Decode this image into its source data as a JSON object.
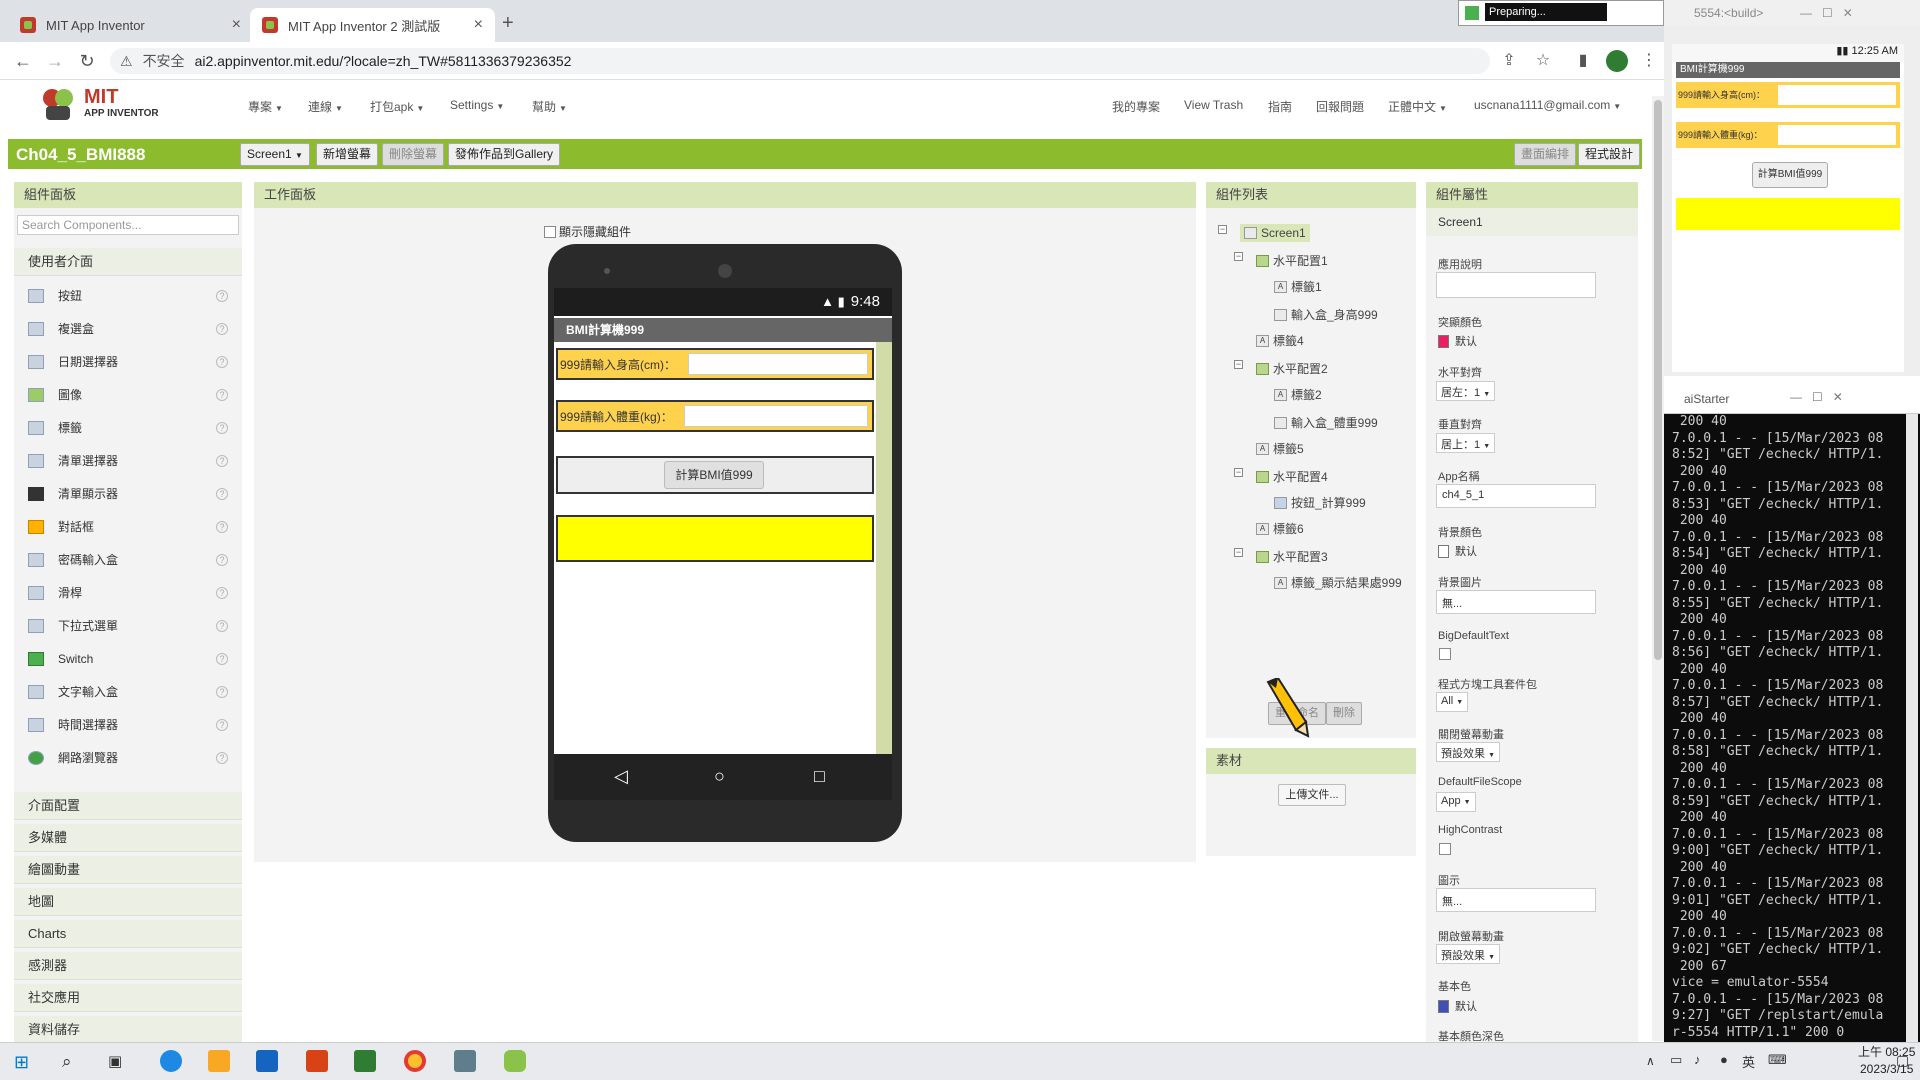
{
  "browser": {
    "tabs": [
      {
        "title": "MIT App Inventor"
      },
      {
        "title": "MIT App Inventor 2 測試版"
      }
    ],
    "insecure_label": "不安全",
    "url": "ai2.appinventor.mit.edu/?locale=zh_TW#5811336379236352"
  },
  "header": {
    "logo_line1": "MIT",
    "logo_line2": "APP INVENTOR",
    "menu_left": [
      "專案",
      "連線",
      "打包apk",
      "Settings",
      "幫助"
    ],
    "menu_right": [
      "我的專案",
      "View Trash",
      "指南",
      "回報問題",
      "正體中文",
      "uscnana1111@gmail.com"
    ]
  },
  "toolbar": {
    "project_name": "Ch04_5_BMI888",
    "screen_select": "Screen1",
    "add_screen": "新增螢幕",
    "remove_screen": "刪除螢幕",
    "publish": "發佈作品到Gallery",
    "designer": "畫面編排",
    "blocks": "程式設計"
  },
  "palette": {
    "title": "組件面板",
    "search_placeholder": "Search Components...",
    "section_ui": "使用者介面",
    "items": [
      "按鈕",
      "複選盒",
      "日期選擇器",
      "圖像",
      "標籤",
      "清單選擇器",
      "清單顯示器",
      "對話框",
      "密碼輸入盒",
      "滑桿",
      "下拉式選單",
      "Switch",
      "文字輸入盒",
      "時間選擇器",
      "網路瀏覽器"
    ],
    "sections": [
      "介面配置",
      "多媒體",
      "繪圖動畫",
      "地圖",
      "Charts",
      "感測器",
      "社交應用",
      "資料儲存"
    ]
  },
  "viewer": {
    "title": "工作面板",
    "show_hidden": "顯示隱藏組件",
    "time": "9:48",
    "app_title": "BMI計算機999",
    "height_label": "999請輸入身高(cm)：",
    "weight_label": "999請輸入體重(kg)：",
    "calc_button": "計算BMI值999"
  },
  "components": {
    "title": "組件列表",
    "tree": [
      "Screen1",
      "水平配置1",
      "標籤1",
      "輸入盒_身高999",
      "標籤4",
      "水平配置2",
      "標籤2",
      "輸入盒_體重999",
      "標籤5",
      "水平配置4",
      "按鈕_計算999",
      "標籤6",
      "水平配置3",
      "標籤_顯示結果處999"
    ],
    "rename": "重新命名",
    "delete": "刪除",
    "media_title": "素材",
    "upload": "上傳文件..."
  },
  "properties": {
    "title": "組件屬性",
    "component": "Screen1",
    "about_label": "應用說明",
    "accent_label": "突顯顏色",
    "accent_value": "默认",
    "accent_color": "#e91e63",
    "halign_label": "水平對齊",
    "halign_value": "居左：1",
    "valign_label": "垂直對齊",
    "valign_value": "居上：1",
    "appname_label": "App名稱",
    "appname_value": "ch4_5_1",
    "bgcolor_label": "背景顏色",
    "bgcolor_value": "默认",
    "bgimage_label": "背景圖片",
    "bgimage_value": "無...",
    "bigtext_label": "BigDefaultText",
    "blocks_toolkit_label": "程式方塊工具套件包",
    "blocks_toolkit_value": "All",
    "close_anim_label": "關閉螢幕動畫",
    "close_anim_value": "預設效果",
    "filescope_label": "DefaultFileScope",
    "filescope_value": "App",
    "highcontrast_label": "HighContrast",
    "icon_label": "圖示",
    "icon_value": "無...",
    "open_anim_label": "開啟螢幕動畫",
    "open_anim_value": "預設效果",
    "primary_label": "基本色",
    "primary_value": "默认",
    "primary_color": "#3f51b5",
    "primary_dark_label": "基本顏色深色"
  },
  "emulator": {
    "title": "5554:<build>",
    "time": "12:25 AM",
    "app_title": "BMI計算機999",
    "height_label": "999請輸入身高(cm)：",
    "weight_label": "999請輸入體重(kg)：",
    "calc_button": "計算BMI值999"
  },
  "preparing": {
    "label": "Preparing..."
  },
  "terminal": {
    "title": "aiStarter",
    "lines": [
      " 200 40",
      "7.0.0.1 - - [15/Mar/2023 08",
      "8:52] \"GET /echeck/ HTTP/1.",
      " 200 40",
      "7.0.0.1 - - [15/Mar/2023 08",
      "8:53] \"GET /echeck/ HTTP/1.",
      " 200 40",
      "7.0.0.1 - - [15/Mar/2023 08",
      "8:54] \"GET /echeck/ HTTP/1.",
      " 200 40",
      "7.0.0.1 - - [15/Mar/2023 08",
      "8:55] \"GET /echeck/ HTTP/1.",
      " 200 40",
      "7.0.0.1 - - [15/Mar/2023 08",
      "8:56] \"GET /echeck/ HTTP/1.",
      " 200 40",
      "7.0.0.1 - - [15/Mar/2023 08",
      "8:57] \"GET /echeck/ HTTP/1.",
      " 200 40",
      "7.0.0.1 - - [15/Mar/2023 08",
      "8:58] \"GET /echeck/ HTTP/1.",
      " 200 40",
      "7.0.0.1 - - [15/Mar/2023 08",
      "8:59] \"GET /echeck/ HTTP/1.",
      " 200 40",
      "7.0.0.1 - - [15/Mar/2023 08",
      "9:00] \"GET /echeck/ HTTP/1.",
      " 200 40",
      "7.0.0.1 - - [15/Mar/2023 08",
      "9:01] \"GET /echeck/ HTTP/1.",
      " 200 40",
      "7.0.0.1 - - [15/Mar/2023 08",
      "9:02] \"GET /echeck/ HTTP/1.",
      " 200 67",
      "vice = emulator-5554",
      "7.0.0.1 - - [15/Mar/2023 08",
      "9:27] \"GET /replstart/emula",
      "r-5554 HTTP/1.1\" 200 0"
    ]
  },
  "taskbar": {
    "ime": "英",
    "time": "上午 08:25",
    "date": "2023/3/15"
  }
}
